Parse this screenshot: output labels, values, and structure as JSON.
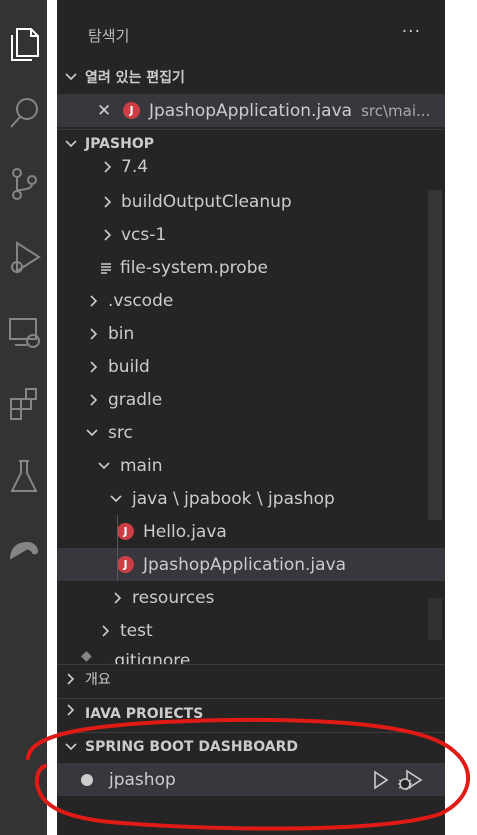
{
  "activity_bar": {
    "icons": [
      "explorer-icon",
      "search-icon",
      "source-control-icon",
      "run-debug-icon",
      "remote-explorer-icon",
      "extensions-icon",
      "testing-icon",
      "gradle-icon"
    ]
  },
  "explorer": {
    "title": "탐색기",
    "more": "···",
    "open_editors": {
      "title": "열려 있는 편집기",
      "items": [
        {
          "close": "✕",
          "name": "JpashopApplication.java",
          "path": "src\\mai..."
        }
      ]
    },
    "project": {
      "title": "JPASHOP",
      "tree": [
        "7.4",
        "buildOutputCleanup",
        "vcs-1",
        "file-system.probe",
        ".vscode",
        "bin",
        "build",
        "gradle",
        "src",
        "main",
        "java \\ jpabook \\ jpashop",
        "Hello.java",
        "JpashopApplication.java",
        "resources",
        "test",
        ".gitignore"
      ]
    },
    "outline": {
      "title": "개요"
    },
    "java_projects": {
      "title": "JAVA PROJECTS"
    },
    "spring_boot_dashboard": {
      "title": "SPRING BOOT DASHBOARD",
      "apps": [
        {
          "name": "jpashop"
        }
      ]
    }
  },
  "colors": {
    "sidebar_bg": "#252526",
    "activity_bar_bg": "#333333",
    "selected_bg": "#37373d",
    "java_icon": "#cc3e44",
    "annotation": "#e01a14"
  }
}
